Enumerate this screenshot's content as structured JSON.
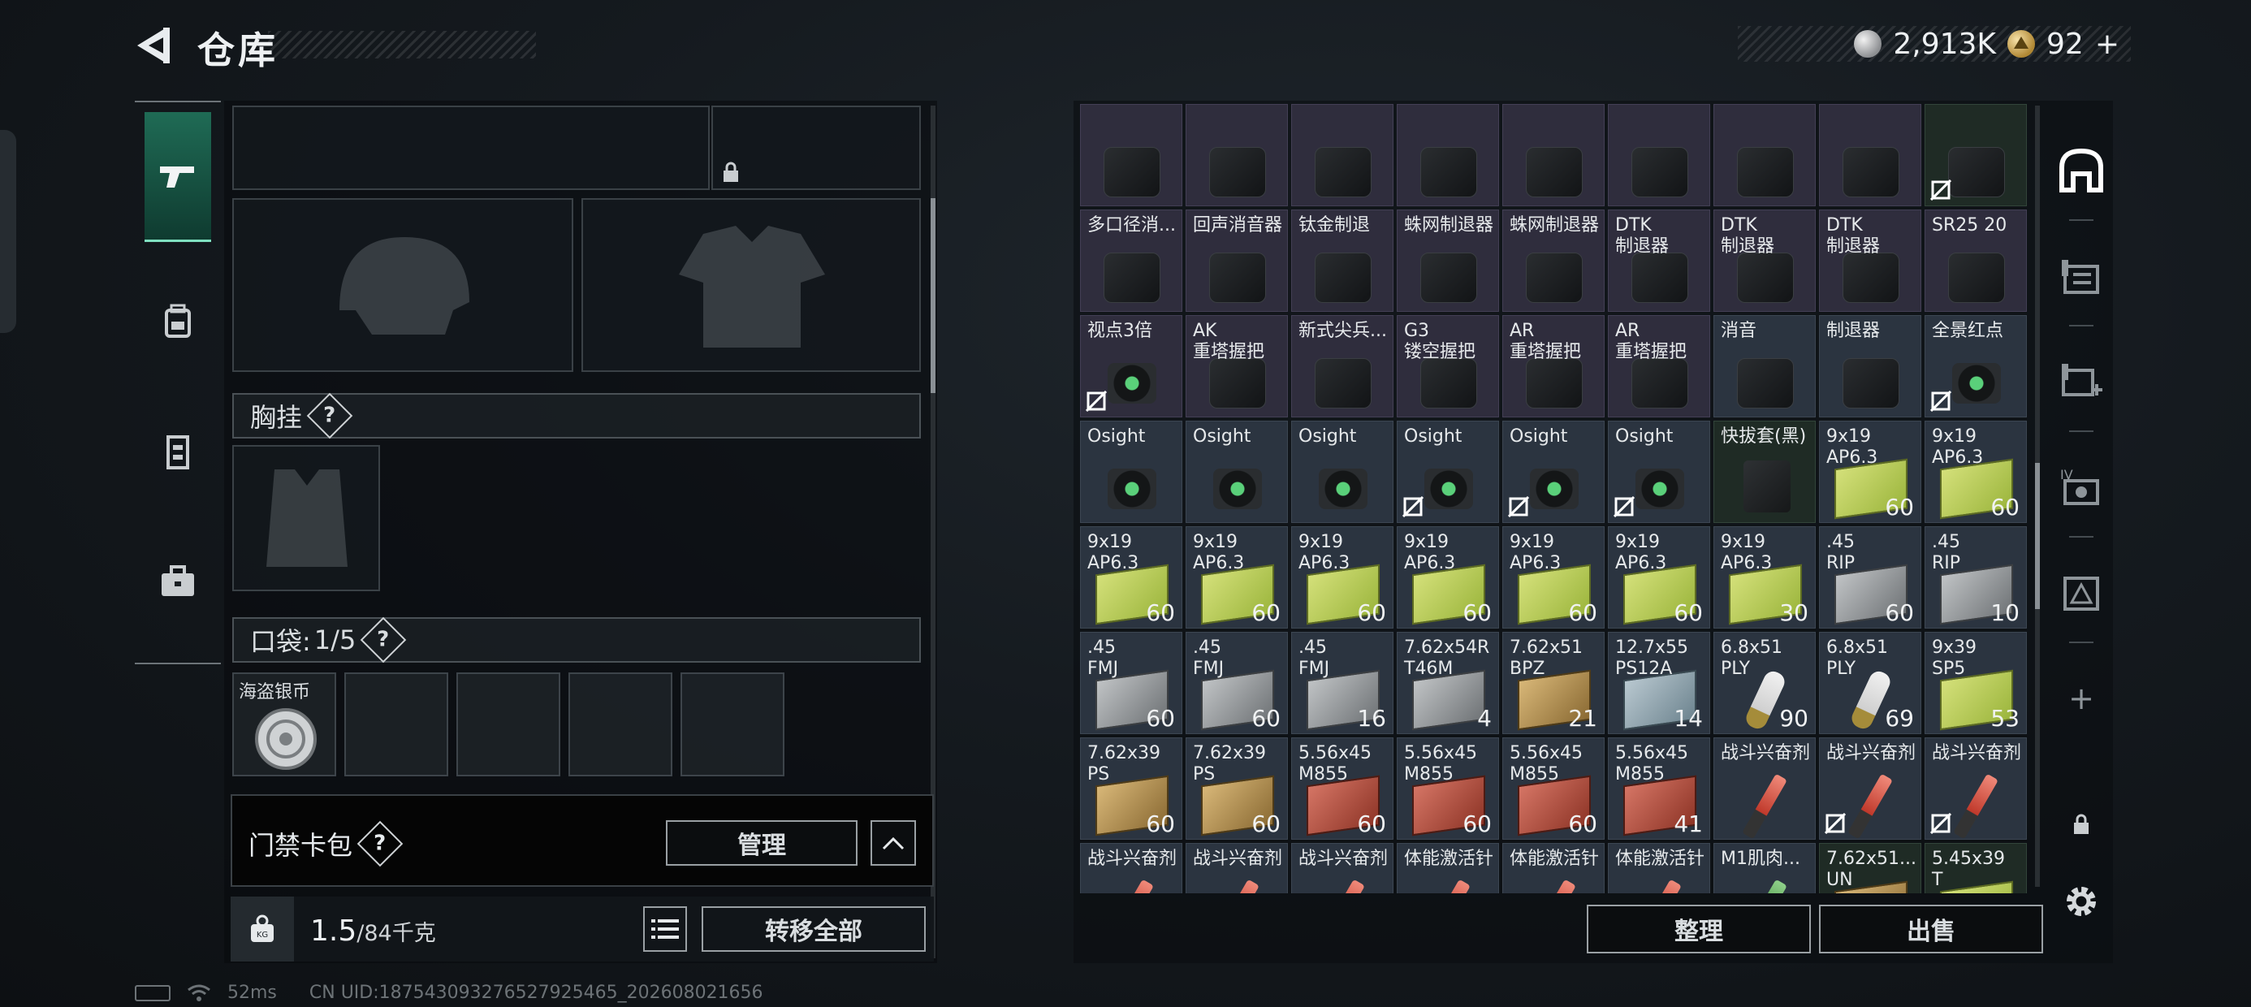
{
  "header": {
    "title": "仓库",
    "currency_silver": "2,913K",
    "currency_gold": "92",
    "gold_add": "+"
  },
  "left_tabs": [
    "weapons-tab",
    "backpack-tab",
    "vest-tab",
    "toolbox-tab"
  ],
  "equipment": {
    "chest_rig_label": "胸挂",
    "pocket_label": "口袋:",
    "pocket_count": "1/5",
    "pocket_items": [
      {
        "name": "海盗银币"
      }
    ],
    "keycard_label": "门禁卡包",
    "manage_label": "管理",
    "weight_value": "1.5",
    "weight_max": "/84千克",
    "kg_badge": "KG",
    "transfer_all_label": "转移全部",
    "help": "?"
  },
  "status": {
    "ping": "52ms",
    "uid": "CN UID:187543093276527925465_202608021656"
  },
  "inventory": {
    "sort_label": "整理",
    "sell_label": "出售",
    "rows": [
      [
        {
          "name": "",
          "bg": "purple",
          "art": "dark-part"
        },
        {
          "name": "",
          "bg": "purple",
          "art": "dark-part"
        },
        {
          "name": "",
          "bg": "purple",
          "art": "dark-part"
        },
        {
          "name": "",
          "bg": "purple",
          "art": "dark-part"
        },
        {
          "name": "",
          "bg": "purple",
          "art": "dark-part"
        },
        {
          "name": "",
          "bg": "purple",
          "art": "dark-part"
        },
        {
          "name": "",
          "bg": "purple",
          "art": "dark-part"
        },
        {
          "name": "",
          "bg": "purple",
          "art": "dark-part"
        },
        {
          "name": "",
          "bg": "green",
          "art": "dark-part",
          "noflag": true
        }
      ],
      [
        {
          "name": "多口径消...",
          "bg": "purple",
          "art": "dark-part"
        },
        {
          "name": "回声消音器",
          "bg": "purple",
          "art": "dark-part"
        },
        {
          "name": "钛金制退",
          "bg": "purple",
          "art": "dark-part"
        },
        {
          "name": "蛛网制退器",
          "bg": "purple",
          "art": "dark-part"
        },
        {
          "name": "蛛网制退器",
          "bg": "purple",
          "art": "dark-part"
        },
        {
          "name": "DTK\n制退器",
          "bg": "purple",
          "art": "dark-part"
        },
        {
          "name": "DTK\n制退器",
          "bg": "purple",
          "art": "dark-part"
        },
        {
          "name": "DTK\n制退器",
          "bg": "purple",
          "art": "dark-part"
        },
        {
          "name": "SR25 20",
          "bg": "purple",
          "art": "dark-part"
        }
      ],
      [
        {
          "name": "视点3倍",
          "bg": "purple",
          "art": "optic",
          "noflag": true
        },
        {
          "name": "AK\n重塔握把",
          "bg": "purple",
          "art": "dark-part"
        },
        {
          "name": "新式尖兵...",
          "bg": "purple",
          "art": "dark-part"
        },
        {
          "name": "G3\n镂空握把",
          "bg": "purple",
          "art": "dark-part"
        },
        {
          "name": "AR\n重塔握把",
          "bg": "purple",
          "art": "dark-part"
        },
        {
          "name": "AR\n重塔握把",
          "bg": "purple",
          "art": "dark-part"
        },
        {
          "name": "消音",
          "bg": "blue",
          "art": "dark-part"
        },
        {
          "name": "制退器",
          "bg": "blue",
          "art": "dark-part"
        },
        {
          "name": "全景红点",
          "bg": "blue",
          "art": "optic",
          "noflag": true
        }
      ],
      [
        {
          "name": "Osight",
          "bg": "blue",
          "art": "optic"
        },
        {
          "name": "Osight",
          "bg": "blue",
          "art": "optic"
        },
        {
          "name": "Osight",
          "bg": "blue",
          "art": "optic"
        },
        {
          "name": "Osight",
          "bg": "blue",
          "art": "optic",
          "noflag": true
        },
        {
          "name": "Osight",
          "bg": "blue",
          "art": "optic",
          "noflag": true
        },
        {
          "name": "Osight",
          "bg": "blue",
          "art": "optic",
          "noflag": true
        },
        {
          "name": "快拔套(黑)",
          "bg": "green",
          "art": "holster"
        },
        {
          "name": "9x19\nAP6.3",
          "bg": "blue",
          "art": "box-green",
          "count": "60"
        },
        {
          "name": "9x19\nAP6.3",
          "bg": "blue",
          "art": "box-green",
          "count": "60"
        }
      ],
      [
        {
          "name": "9x19\nAP6.3",
          "bg": "blue",
          "art": "box-green",
          "count": "60"
        },
        {
          "name": "9x19\nAP6.3",
          "bg": "blue",
          "art": "box-green",
          "count": "60"
        },
        {
          "name": "9x19\nAP6.3",
          "bg": "blue",
          "art": "box-green",
          "count": "60"
        },
        {
          "name": "9x19\nAP6.3",
          "bg": "blue",
          "art": "box-green",
          "count": "60"
        },
        {
          "name": "9x19\nAP6.3",
          "bg": "blue",
          "art": "box-green",
          "count": "60"
        },
        {
          "name": "9x19\nAP6.3",
          "bg": "blue",
          "art": "box-green",
          "count": "60"
        },
        {
          "name": "9x19\nAP6.3",
          "bg": "blue",
          "art": "box-green",
          "count": "30"
        },
        {
          "name": ".45\nRIP",
          "bg": "blue",
          "art": "box-gray",
          "count": "60"
        },
        {
          "name": ".45\nRIP",
          "bg": "blue",
          "art": "box-gray",
          "count": "10"
        }
      ],
      [
        {
          "name": ".45\nFMJ",
          "bg": "blue",
          "art": "box-gray",
          "count": "60"
        },
        {
          "name": ".45\nFMJ",
          "bg": "blue",
          "art": "box-gray",
          "count": "60"
        },
        {
          "name": ".45\nFMJ",
          "bg": "blue",
          "art": "box-gray",
          "count": "16"
        },
        {
          "name": "7.62x54R\nT46M",
          "bg": "blue",
          "art": "box-gray",
          "count": "4"
        },
        {
          "name": "7.62x51\nBPZ",
          "bg": "blue",
          "art": "box-tan",
          "count": "21"
        },
        {
          "name": "12.7x55\nPS12A",
          "bg": "blue",
          "art": "box-blue",
          "count": "14"
        },
        {
          "name": "6.8x51\nPLY",
          "bg": "blue",
          "art": "shell",
          "count": "90"
        },
        {
          "name": "6.8x51\nPLY",
          "bg": "blue",
          "art": "shell",
          "count": "69"
        },
        {
          "name": "9x39\nSP5",
          "bg": "blue",
          "art": "box-green",
          "count": "53"
        }
      ],
      [
        {
          "name": "7.62x39\nPS",
          "bg": "blue",
          "art": "box-tan",
          "count": "60"
        },
        {
          "name": "7.62x39\nPS",
          "bg": "blue",
          "art": "box-tan",
          "count": "60"
        },
        {
          "name": "5.56x45\nM855",
          "bg": "blue",
          "art": "box-red",
          "count": "60"
        },
        {
          "name": "5.56x45\nM855",
          "bg": "blue",
          "art": "box-red",
          "count": "60"
        },
        {
          "name": "5.56x45\nM855",
          "bg": "blue",
          "art": "box-red",
          "count": "60"
        },
        {
          "name": "5.56x45\nM855",
          "bg": "blue",
          "art": "box-red",
          "count": "41"
        },
        {
          "name": "战斗兴奋剂",
          "bg": "blue",
          "art": "syringe"
        },
        {
          "name": "战斗兴奋剂",
          "bg": "blue",
          "art": "syringe",
          "noflag": true
        },
        {
          "name": "战斗兴奋剂",
          "bg": "blue",
          "art": "syringe",
          "noflag": true
        }
      ],
      [
        {
          "name": "战斗兴奋剂",
          "bg": "blue",
          "art": "syringe"
        },
        {
          "name": "战斗兴奋剂",
          "bg": "blue",
          "art": "syringe"
        },
        {
          "name": "战斗兴奋剂",
          "bg": "blue",
          "art": "syringe"
        },
        {
          "name": "体能激活针",
          "bg": "blue",
          "art": "syringe"
        },
        {
          "name": "体能激活针",
          "bg": "blue",
          "art": "syringe"
        },
        {
          "name": "体能激活针",
          "bg": "blue",
          "art": "syringe"
        },
        {
          "name": "M1肌肉...",
          "bg": "blue",
          "art": "syringe green"
        },
        {
          "name": "7.62x51...\nUN",
          "bg": "green",
          "art": "box-tan"
        },
        {
          "name": "5.45x39\nT",
          "bg": "green",
          "art": "box-green"
        }
      ]
    ]
  },
  "side_icons": [
    "helmet-tab-icon",
    "supply-crate-icon",
    "add-card-icon",
    "level-iv-gear-icon",
    "warning-crate-icon",
    "add-icon",
    "lock-icon",
    "settings-icon"
  ],
  "add_symbol": "+"
}
